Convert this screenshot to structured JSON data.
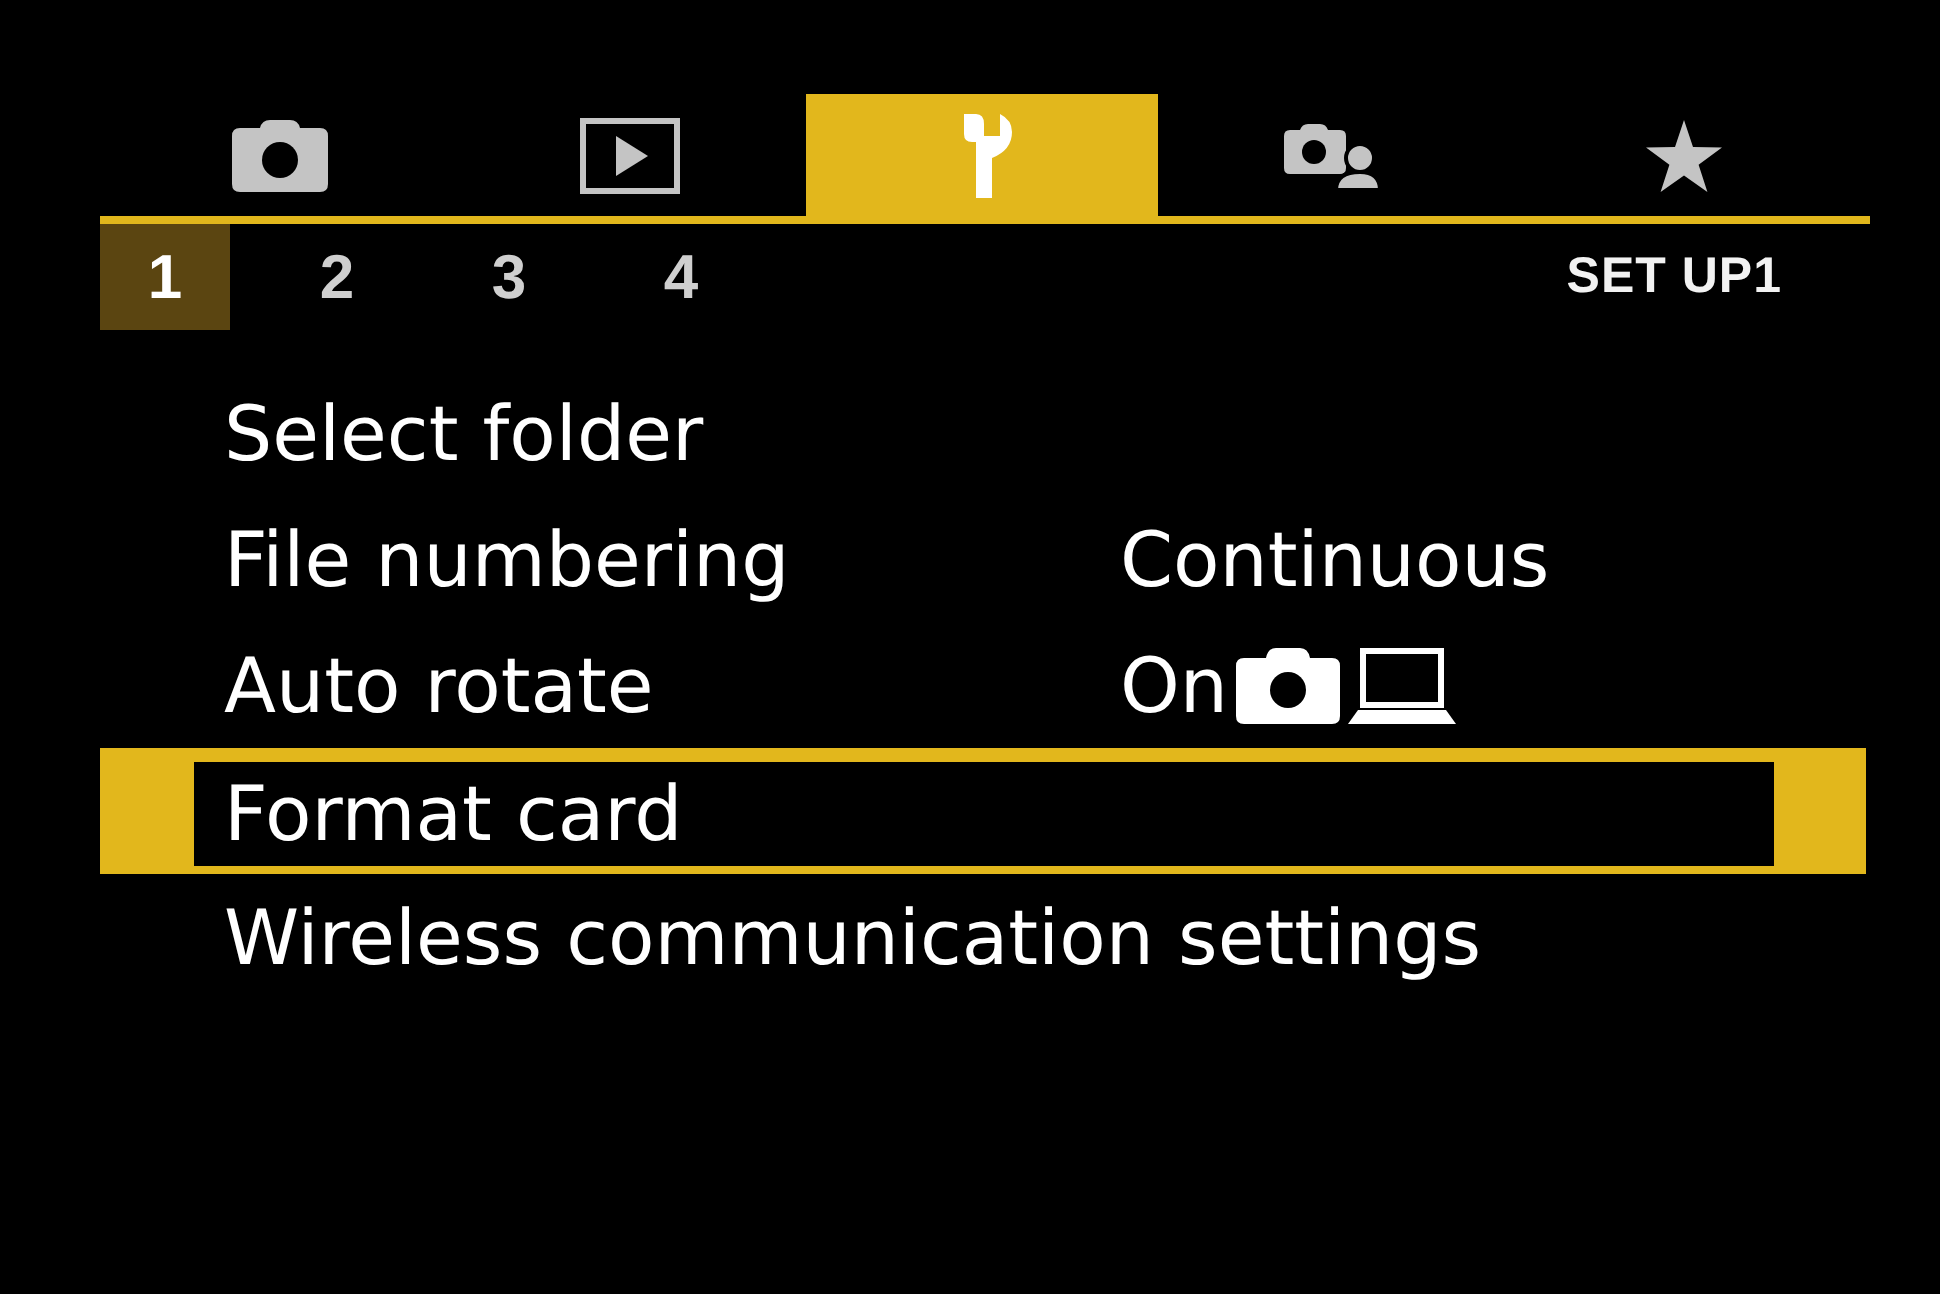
{
  "tabs": [
    {
      "kind": "shooting",
      "selected": false
    },
    {
      "kind": "playback",
      "selected": false
    },
    {
      "kind": "setup",
      "selected": true
    },
    {
      "kind": "custom",
      "selected": false
    },
    {
      "kind": "my_menu",
      "selected": false
    }
  ],
  "sub_tabs": [
    {
      "label": "1",
      "selected": true
    },
    {
      "label": "2",
      "selected": false
    },
    {
      "label": "3",
      "selected": false
    },
    {
      "label": "4",
      "selected": false
    }
  ],
  "page_label": "SET UP1",
  "menu": [
    {
      "kind": "setting",
      "label": "Select folder",
      "selected": false
    },
    {
      "kind": "setting",
      "label": "File numbering",
      "value": "Continuous",
      "selected": false
    },
    {
      "kind": "rotate_setting",
      "label": "Auto rotate",
      "value": "On",
      "selected": false
    },
    {
      "kind": "setting",
      "label": "Format card",
      "selected": true
    },
    {
      "kind": "setting",
      "label": "Wireless communication settings",
      "selected": false
    }
  ]
}
